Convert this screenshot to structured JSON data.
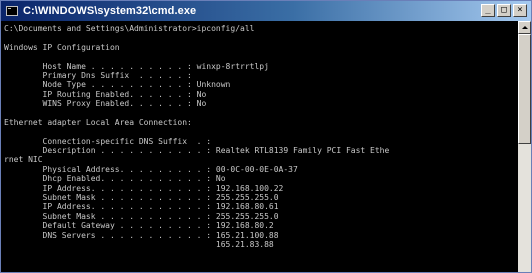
{
  "window": {
    "title": "C:\\WINDOWS\\system32\\cmd.exe",
    "buttons": {
      "minimize": "_",
      "maximize": "□",
      "close": "×"
    }
  },
  "console": {
    "lines": [
      "C:\\Documents and Settings\\Administrator>ipconfig/all",
      "",
      "Windows IP Configuration",
      "",
      "        Host Name . . . . . . . . . . : winxp-8rtrrtlpj",
      "        Primary Dns Suffix  . . . . . :",
      "        Node Type . . . . . . . . . . : Unknown",
      "        IP Routing Enabled. . . . . . : No",
      "        WINS Proxy Enabled. . . . . . : No",
      "",
      "Ethernet adapter Local Area Connection:",
      "",
      "        Connection-specific DNS Suffix  . :",
      "        Description . . . . . . . . . . . : Realtek RTL8139 Family PCI Fast Ethe",
      "rnet NIC",
      "        Physical Address. . . . . . . . . : 00-0C-00-0E-0A-37",
      "        Dhcp Enabled. . . . . . . . . . . : No",
      "        IP Address. . . . . . . . . . . . : 192.168.100.22",
      "        Subnet Mask . . . . . . . . . . . : 255.255.255.0",
      "        IP Address. . . . . . . . . . . . : 192.168.80.61",
      "        Subnet Mask . . . . . . . . . . . : 255.255.255.0",
      "        Default Gateway . . . . . . . . . : 192.168.80.2",
      "        DNS Servers . . . . . . . . . . . : 165.21.100.88",
      "                                            165.21.83.88"
    ]
  }
}
